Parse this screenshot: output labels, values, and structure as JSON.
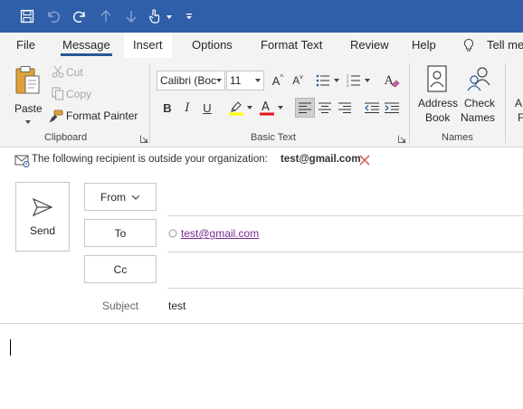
{
  "quick_access": {
    "items": [
      "save-icon",
      "undo-icon",
      "redo-icon",
      "previous-item-icon",
      "next-item-icon",
      "touch-mode-icon",
      "customize-toolbar-icon"
    ]
  },
  "tabs": [
    {
      "label": "File"
    },
    {
      "label": "Message",
      "active": true
    },
    {
      "label": "Insert"
    },
    {
      "label": "Options"
    },
    {
      "label": "Format Text"
    },
    {
      "label": "Review"
    },
    {
      "label": "Help"
    },
    {
      "label": "Tell me"
    }
  ],
  "ribbon": {
    "clipboard": {
      "paste": "Paste",
      "cut": "Cut",
      "copy": "Copy",
      "format_painter": "Format Painter",
      "label": "Clipboard"
    },
    "basic_text": {
      "font_name": "Calibri (Boc",
      "font_size": "11",
      "grow_font": "A",
      "shrink_font": "A",
      "bold": "B",
      "italic": "I",
      "underline": "U",
      "label": "Basic Text"
    },
    "names": {
      "address_book_line1": "Address",
      "address_book_line2": "Book",
      "check_names_line1": "Check",
      "check_names_line2": "Names",
      "label": "Names"
    },
    "partial_next": {
      "line1": "A",
      "line2": "F"
    }
  },
  "notice": {
    "text": "The following recipient is outside your organization:",
    "email": "test@gmail.com"
  },
  "compose": {
    "send_label": "Send",
    "from_label": "From",
    "to_label": "To",
    "cc_label": "Cc",
    "to_value": "test@gmail.com",
    "subject_label": "Subject",
    "subject_value": "test"
  },
  "colors": {
    "titlebar": "#2f5fa8",
    "accent": "#2b579a",
    "highlight_yellow": "#ffff00",
    "font_red": "#e81123",
    "recipient_link": "#7a2a8f"
  }
}
